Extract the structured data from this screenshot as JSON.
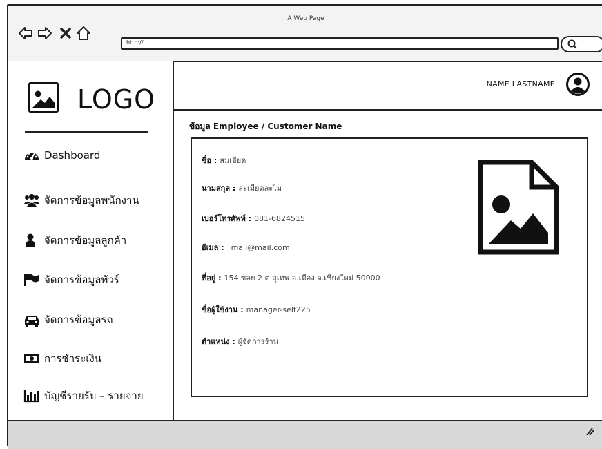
{
  "window": {
    "title": "A Web Page",
    "url": "http://"
  },
  "sidebar": {
    "logo_text": "LOGO",
    "items": [
      {
        "label": "Dashboard",
        "icon": "dashboard-icon"
      },
      {
        "label": "จัดการข้อมูลพนักงาน",
        "icon": "users-icon"
      },
      {
        "label": "จัดการข้อมูลลูกค้า",
        "icon": "user-icon"
      },
      {
        "label": "จัดการข้อมูลทัวร์",
        "icon": "flag-icon"
      },
      {
        "label": "จัดการข้อมูลรถ",
        "icon": "car-icon"
      },
      {
        "label": "การชำระเงิน",
        "icon": "money-icon"
      },
      {
        "label": "บัญชีรายรับ – รายจ่าย",
        "icon": "bar-chart-icon"
      }
    ]
  },
  "header": {
    "user_name": "NAME LASTNAME"
  },
  "main": {
    "title": "ข้อมูล Employee / Customer Name",
    "fields": [
      {
        "label": "ชื่อ :",
        "value": "สมเฮียด"
      },
      {
        "label": "นามสกุล :",
        "value": "ละเมียดละไม"
      },
      {
        "label": "เบอร์โทรศัพท์ :",
        "value": "081-6824515"
      },
      {
        "label": "อีเมล :",
        "value": "mail@mail.com"
      },
      {
        "label": "ที่อยู่ :",
        "value": "154 ซอย 2 ต.สุเทพ อ.เมือง จ.เชียงใหม่ 50000"
      },
      {
        "label": "ชื่อผู้ใช้งาน :",
        "value": "manager-self225"
      },
      {
        "label": "ตำแหน่ง :",
        "value": "ผู้จัดการร้าน"
      }
    ]
  }
}
